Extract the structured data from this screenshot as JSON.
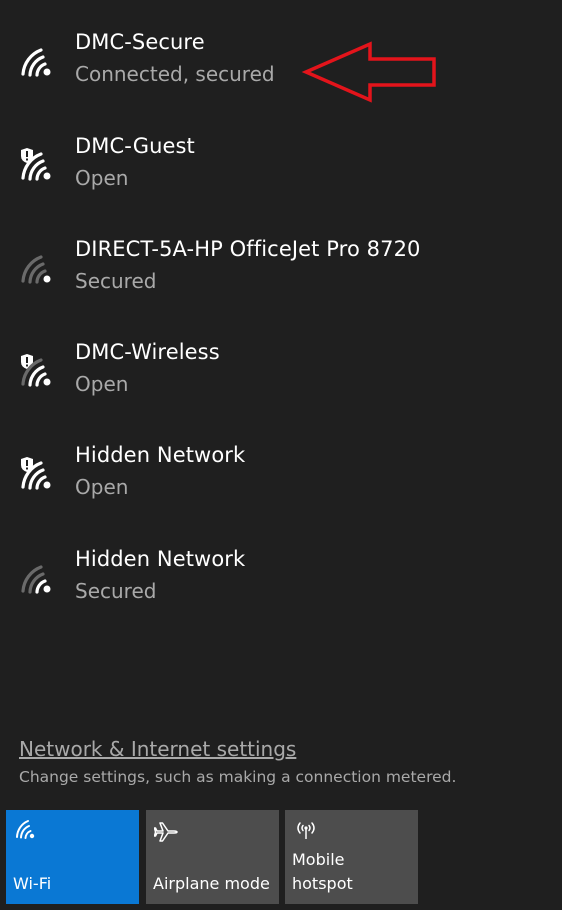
{
  "networks": [
    {
      "name": "DMC-Secure",
      "status": "Connected, secured",
      "icon": "wifi-signal-icon",
      "shield": false,
      "strength": "full"
    },
    {
      "name": "DMC-Guest",
      "status": "Open",
      "icon": "wifi-open-shield-icon",
      "shield": true,
      "strength": "full"
    },
    {
      "name": "DIRECT-5A-HP OfficeJet Pro 8720",
      "status": "Secured",
      "icon": "wifi-signal-weak-icon",
      "shield": false,
      "strength": "weak"
    },
    {
      "name": "DMC-Wireless",
      "status": "Open",
      "icon": "wifi-open-shield-icon",
      "shield": true,
      "strength": "partial"
    },
    {
      "name": "Hidden Network",
      "status": "Open",
      "icon": "wifi-open-shield-icon",
      "shield": true,
      "strength": "full"
    },
    {
      "name": "Hidden Network",
      "status": "Secured",
      "icon": "wifi-signal-weak-icon",
      "shield": false,
      "strength": "partial"
    }
  ],
  "settings": {
    "link": "Network & Internet settings",
    "description": "Change settings, such as making a connection metered."
  },
  "quick_actions": [
    {
      "label": "Wi-Fi",
      "icon": "wifi-icon",
      "active": true
    },
    {
      "label": "Airplane mode",
      "icon": "airplane-icon",
      "active": false
    },
    {
      "label": "Mobile hotspot",
      "icon": "hotspot-icon",
      "active": false
    }
  ],
  "colors": {
    "background": "#1f1f1f",
    "tile": "#4d4d4d",
    "tile_active": "#0a78d4",
    "secondary_text": "#a9a9a9",
    "annotation": "#e3141b"
  }
}
